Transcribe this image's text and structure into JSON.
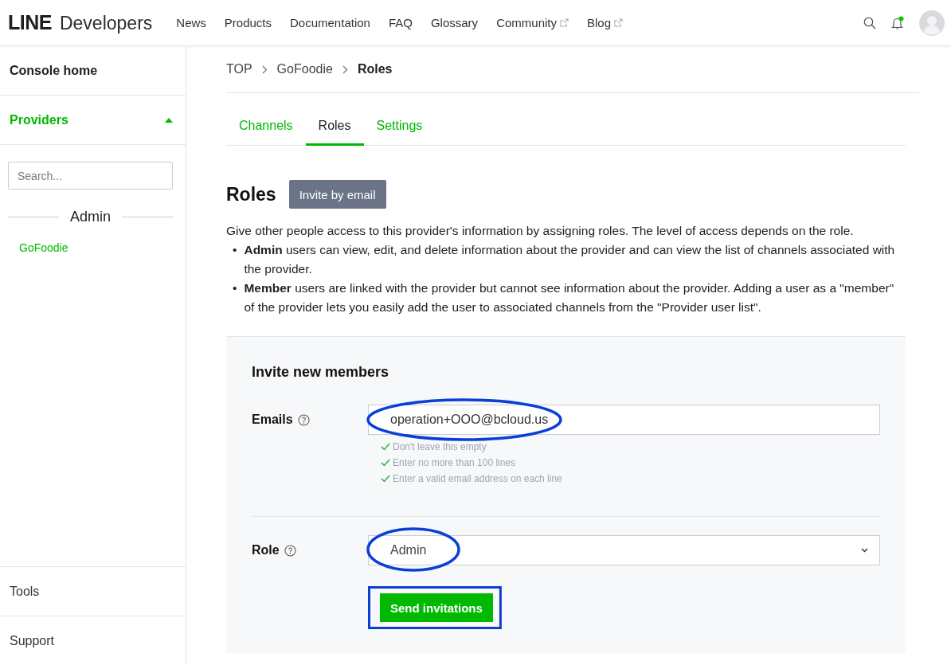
{
  "header": {
    "logo_bold": "LINE",
    "logo_text": "Developers",
    "nav": [
      {
        "label": "News",
        "external": false
      },
      {
        "label": "Products",
        "external": false
      },
      {
        "label": "Documentation",
        "external": false
      },
      {
        "label": "FAQ",
        "external": false
      },
      {
        "label": "Glossary",
        "external": false
      },
      {
        "label": "Community",
        "external": true
      },
      {
        "label": "Blog",
        "external": true
      }
    ],
    "notification_dot": true
  },
  "sidebar": {
    "console_home": "Console home",
    "providers": {
      "label": "Providers",
      "expanded": true
    },
    "search": {
      "placeholder": "Search..."
    },
    "group_label": "Admin",
    "items": [
      "GoFoodie"
    ],
    "footer": [
      "Tools",
      "Support"
    ]
  },
  "breadcrumb": [
    {
      "label": "TOP",
      "current": false
    },
    {
      "label": "GoFoodie",
      "current": false
    },
    {
      "label": "Roles",
      "current": true
    }
  ],
  "tabs": [
    {
      "label": "Channels",
      "selected": false
    },
    {
      "label": "Roles",
      "selected": true
    },
    {
      "label": "Settings",
      "selected": false
    }
  ],
  "page": {
    "title": "Roles",
    "invite_button": "Invite by email",
    "bullet_marker": "•",
    "intro": "Give other people access to this provider's information by assigning roles. The level of access depends on the role.",
    "bullets": [
      "**Admin** users can view, edit, and delete information about the provider and can view the list of channels associated with the provider.",
      "**Member** users are linked with the provider but cannot see information about the provider. Adding a user as a \"member\" of the provider lets you easily add the user to associated channels from the \"Provider user list\"."
    ]
  },
  "invite": {
    "title": "Invite new members",
    "emails": {
      "label": "Emails",
      "value": "operation+OOO@bcloud.us",
      "rules": [
        "Don't leave this empty",
        "Enter no more than 100 lines",
        "Enter a valid email address on each line"
      ]
    },
    "role": {
      "label": "Role",
      "value": "Admin"
    },
    "submit": "Send invitations"
  }
}
